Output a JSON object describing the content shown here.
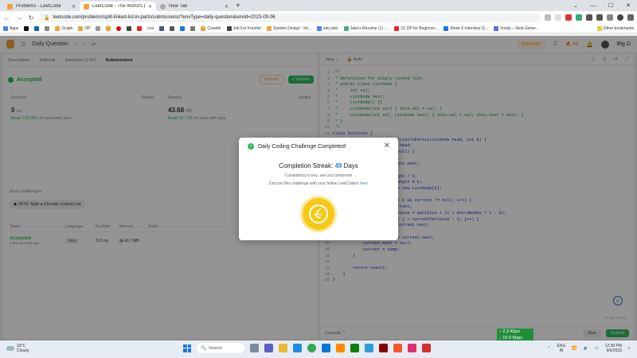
{
  "browser": {
    "tabs": [
      {
        "title": "Problems - LeetCode",
        "active": false
      },
      {
        "title": "LeetCode - The World's Leading",
        "active": true
      },
      {
        "title": "New Tab",
        "active": false
      }
    ],
    "new_tab_glyph": "+",
    "url": "leetcode.com/problems/split-linked-list-in-parts/submissions/?envType=daily-question&envId=2023-09-06"
  },
  "bookmarks": {
    "items": [
      "Apps",
      "Graph",
      "DP",
      "Lex",
      "Cuvette",
      "Job For Fresher",
      "System Design - Int...",
      "sde jobs",
      "Jake's Resume (1) -...",
      "(1) DP for Beginner...",
      "Week 6 Interview Q...",
      "Vondy – Next Gener..."
    ],
    "other": "Other bookmarks"
  },
  "lc_header": {
    "title": "Daily Question",
    "premium": "Premium",
    "streak": "49",
    "username": "Big Ω"
  },
  "left_panel": {
    "tabs": [
      "Description",
      "Editorial",
      "Solutions (1.5K)",
      "Submissions"
    ],
    "status": "Accepted",
    "editorial_btn": "Editorial",
    "solution_btn": "+ Solution",
    "runtime": {
      "label": "Runtime",
      "details": "Details",
      "value": "0",
      "unit": "ms",
      "beats_pct": "Beats 100.00%",
      "beats_rest": "of users with Java"
    },
    "memory": {
      "label": "Memory",
      "details": "Details",
      "value": "43.68",
      "unit": "MB",
      "beats_pct": "Beats 52.77%",
      "beats_rest": "of users with Java"
    },
    "more_challenges": "More challenges",
    "challenge": "2674. Split a Circular Linked List",
    "table_headers": [
      "Status",
      "Language",
      "Runtime",
      "Memory",
      "Notes"
    ],
    "row": {
      "status": "Accepted",
      "time": "a few seconds ago",
      "language": "Java",
      "runtime": "0 ms",
      "memory": "43.7 MB"
    }
  },
  "right_panel": {
    "language": "Java",
    "mode": "Auto",
    "code_lines": [
      {
        "n": "1",
        "t": "/**",
        "kw": false
      },
      {
        "n": "2",
        "t": " * Definition for singly-linked list.",
        "kw": false
      },
      {
        "n": "3",
        "t": " * public class ListNode {",
        "kw": false
      },
      {
        "n": "4",
        "t": " *     int val;",
        "kw": false
      },
      {
        "n": "5",
        "t": " *     ListNode next;",
        "kw": false
      },
      {
        "n": "6",
        "t": " *     ListNode() {}",
        "kw": false
      },
      {
        "n": "7",
        "t": " *     ListNode(int val) { this.val = val; }",
        "kw": false
      },
      {
        "n": "8",
        "t": " *     ListNode(int val, ListNode next) { this.val = val; this.next = next; }",
        "kw": false
      },
      {
        "n": "9",
        "t": " * }",
        "kw": false
      },
      {
        "n": "10",
        "t": " */",
        "kw": false
      },
      {
        "n": "11",
        "t": "class Solution {",
        "kw": true
      },
      {
        "n": "12",
        "t": "    public ListNode[] splitListToParts(ListNode head, int k) {",
        "kw": true
      },
      {
        "n": "13",
        "t": "        ListNode current = head;",
        "kw": true
      },
      {
        "n": "14",
        "t": "        while (current != null) {",
        "kw": true
      },
      {
        "n": "15",
        "t": "            length++;",
        "kw": true
      },
      {
        "n": "16",
        "t": "            current = current.next;",
        "kw": true
      },
      {
        "n": "17",
        "t": "        }",
        "kw": true
      },
      {
        "n": "18",
        "t": "        int partSize = length / k;",
        "kw": true
      },
      {
        "n": "19",
        "t": "        int extraNodes = length % k;",
        "kw": true
      },
      {
        "n": "20",
        "t": "        ListNode[] result = new ListNode[k];",
        "kw": true
      },
      {
        "n": "21",
        "t": "        current = head;",
        "kw": true
      },
      {
        "n": "22",
        "t": "        for (int i = 0; i < k && current != null; i++) {",
        "kw": true
      },
      {
        "n": "23",
        "t": "            result[i] = current;",
        "kw": true
      },
      {
        "n": "24",
        "t": "            int currentPartSize = partSize + (i < extraNodes ? 1 : 0);",
        "kw": true
      },
      {
        "n": "25",
        "t": "            for (int j = 0; j < currentPartSize - 1; j++) {",
        "kw": true
      },
      {
        "n": "26",
        "t": "                current = current.next;",
        "kw": true
      },
      {
        "n": "27",
        "t": "            }",
        "kw": true
      },
      {
        "n": "28",
        "t": "            ListNode temp = current.next;",
        "kw": true
      },
      {
        "n": "29",
        "t": "            current.next = null;",
        "kw": true
      },
      {
        "n": "30",
        "t": "            current = temp;",
        "kw": true
      },
      {
        "n": "31",
        "t": "        }",
        "kw": true
      },
      {
        "n": "32",
        "t": "",
        "kw": true
      },
      {
        "n": "33",
        "t": "        return result;",
        "kw": true
      },
      {
        "n": "34",
        "t": "    }",
        "kw": true
      },
      {
        "n": "35",
        "t": "}",
        "kw": true
      }
    ],
    "cursor_pos": "Ln 18, Col 12",
    "console": "Console",
    "run": "Run",
    "submit": "Submit"
  },
  "modal": {
    "title": "Daily Coding Challenge Completed!",
    "streak_label": "Completion Streak:",
    "streak_value": "49",
    "streak_unit": "Days",
    "line1": "Consistency is key, see you tomorrow!",
    "line2": "Discuss this challenge with your fellow LeetCoders",
    "link": "here"
  },
  "netspeed": {
    "up": "↑ 2.3 Kbps",
    "down": "↓ 10.9 Kbps"
  },
  "taskbar": {
    "weather_temp": "33°C",
    "weather_desc": "Cloudy",
    "search": "Search",
    "lang1": "ENG",
    "lang2": "IN",
    "time": "12:38 PM",
    "date": "9/6/2023"
  },
  "colors": {
    "accent_green": "#2cbb5d",
    "streak_blue": "#2f7fd6",
    "badge_yellow": "#f6c915"
  }
}
